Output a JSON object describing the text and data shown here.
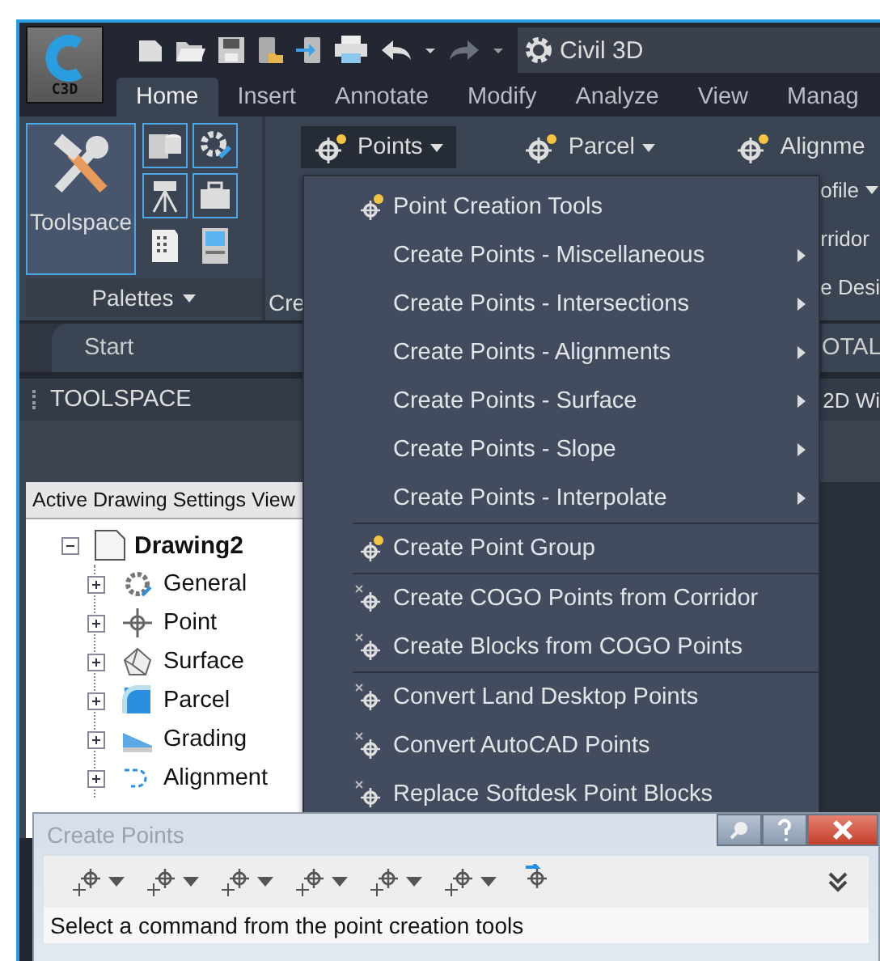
{
  "app_button": {
    "label": "C3D"
  },
  "workspace": {
    "label": "Civil 3D"
  },
  "tabs": [
    {
      "label": "Home",
      "selected": true
    },
    {
      "label": "Insert",
      "selected": false
    },
    {
      "label": "Annotate",
      "selected": false
    },
    {
      "label": "Modify",
      "selected": false
    },
    {
      "label": "Analyze",
      "selected": false
    },
    {
      "label": "View",
      "selected": false
    },
    {
      "label": "Manag",
      "selected": false
    }
  ],
  "ribbon": {
    "big_button": "Toolspace",
    "panel_label": "Palettes",
    "panel_2_label": "Cre",
    "buttons": [
      {
        "label": "Points",
        "open": true
      },
      {
        "label": "Parcel",
        "open": false
      },
      {
        "label": "Alignme",
        "open": false
      }
    ],
    "covered_items": [
      {
        "label": "ofile",
        "caret": true
      },
      {
        "label": "rridor",
        "caret": false
      },
      {
        "label": "e Desi",
        "caret": false
      }
    ]
  },
  "document_tabs": [
    {
      "label": "Start",
      "selected": true
    },
    {
      "label": "OTAL",
      "selected": false
    }
  ],
  "palette": {
    "title": "TOOLSPACE",
    "covered_text": "2D Wi"
  },
  "tree": {
    "header": "Active Drawing Settings View",
    "root": {
      "label": "Drawing2",
      "expanded": true,
      "children": [
        {
          "label": "General",
          "expanded": false
        },
        {
          "label": "Point",
          "expanded": false
        },
        {
          "label": "Surface",
          "expanded": false
        },
        {
          "label": "Parcel",
          "expanded": false
        },
        {
          "label": "Grading",
          "expanded": false
        },
        {
          "label": "Alignment",
          "expanded": false
        }
      ]
    }
  },
  "menu": {
    "groups": [
      {
        "items": [
          {
            "label": "Point Creation Tools",
            "kind": "tool"
          },
          {
            "label": "Create Points - Miscellaneous",
            "kind": "submenu"
          },
          {
            "label": "Create Points - Intersections",
            "kind": "submenu"
          },
          {
            "label": "Create Points - Alignments",
            "kind": "submenu"
          },
          {
            "label": "Create Points - Surface",
            "kind": "submenu"
          },
          {
            "label": "Create Points - Slope",
            "kind": "submenu"
          },
          {
            "label": "Create Points - Interpolate",
            "kind": "submenu"
          }
        ]
      },
      {
        "items": [
          {
            "label": "Create Point Group",
            "kind": "tool"
          }
        ]
      },
      {
        "items": [
          {
            "label": "Create COGO Points from Corridor",
            "kind": "tool"
          },
          {
            "label": "Create Blocks from COGO Points",
            "kind": "tool"
          }
        ]
      },
      {
        "items": [
          {
            "label": "Convert Land Desktop Points",
            "kind": "tool"
          },
          {
            "label": "Convert AutoCAD Points",
            "kind": "tool"
          },
          {
            "label": "Replace Softdesk Point Blocks",
            "kind": "tool"
          }
        ]
      }
    ]
  },
  "dialog": {
    "title": "Create Points",
    "status": "Select a command from the point creation tools",
    "tools": [
      {
        "caret": true
      },
      {
        "caret": true
      },
      {
        "caret": true
      },
      {
        "caret": true
      },
      {
        "caret": true
      },
      {
        "caret": true
      },
      {
        "caret": false
      }
    ]
  }
}
